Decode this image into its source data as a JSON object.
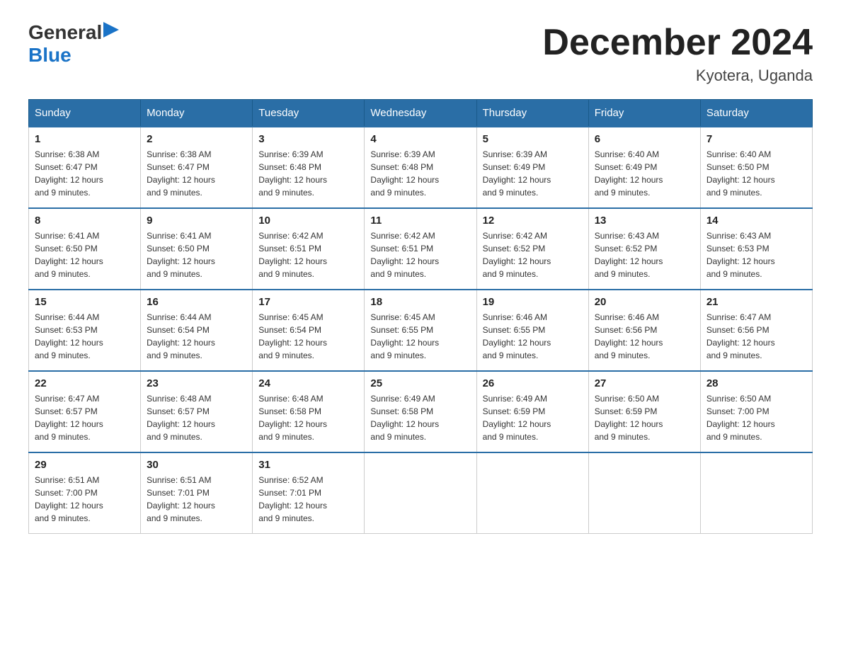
{
  "logo": {
    "general": "General",
    "blue": "Blue"
  },
  "title": "December 2024",
  "subtitle": "Kyotera, Uganda",
  "weekdays": [
    "Sunday",
    "Monday",
    "Tuesday",
    "Wednesday",
    "Thursday",
    "Friday",
    "Saturday"
  ],
  "weeks": [
    [
      {
        "day": "1",
        "sunrise": "6:38 AM",
        "sunset": "6:47 PM",
        "daylight": "12 hours and 9 minutes."
      },
      {
        "day": "2",
        "sunrise": "6:38 AM",
        "sunset": "6:47 PM",
        "daylight": "12 hours and 9 minutes."
      },
      {
        "day": "3",
        "sunrise": "6:39 AM",
        "sunset": "6:48 PM",
        "daylight": "12 hours and 9 minutes."
      },
      {
        "day": "4",
        "sunrise": "6:39 AM",
        "sunset": "6:48 PM",
        "daylight": "12 hours and 9 minutes."
      },
      {
        "day": "5",
        "sunrise": "6:39 AM",
        "sunset": "6:49 PM",
        "daylight": "12 hours and 9 minutes."
      },
      {
        "day": "6",
        "sunrise": "6:40 AM",
        "sunset": "6:49 PM",
        "daylight": "12 hours and 9 minutes."
      },
      {
        "day": "7",
        "sunrise": "6:40 AM",
        "sunset": "6:50 PM",
        "daylight": "12 hours and 9 minutes."
      }
    ],
    [
      {
        "day": "8",
        "sunrise": "6:41 AM",
        "sunset": "6:50 PM",
        "daylight": "12 hours and 9 minutes."
      },
      {
        "day": "9",
        "sunrise": "6:41 AM",
        "sunset": "6:50 PM",
        "daylight": "12 hours and 9 minutes."
      },
      {
        "day": "10",
        "sunrise": "6:42 AM",
        "sunset": "6:51 PM",
        "daylight": "12 hours and 9 minutes."
      },
      {
        "day": "11",
        "sunrise": "6:42 AM",
        "sunset": "6:51 PM",
        "daylight": "12 hours and 9 minutes."
      },
      {
        "day": "12",
        "sunrise": "6:42 AM",
        "sunset": "6:52 PM",
        "daylight": "12 hours and 9 minutes."
      },
      {
        "day": "13",
        "sunrise": "6:43 AM",
        "sunset": "6:52 PM",
        "daylight": "12 hours and 9 minutes."
      },
      {
        "day": "14",
        "sunrise": "6:43 AM",
        "sunset": "6:53 PM",
        "daylight": "12 hours and 9 minutes."
      }
    ],
    [
      {
        "day": "15",
        "sunrise": "6:44 AM",
        "sunset": "6:53 PM",
        "daylight": "12 hours and 9 minutes."
      },
      {
        "day": "16",
        "sunrise": "6:44 AM",
        "sunset": "6:54 PM",
        "daylight": "12 hours and 9 minutes."
      },
      {
        "day": "17",
        "sunrise": "6:45 AM",
        "sunset": "6:54 PM",
        "daylight": "12 hours and 9 minutes."
      },
      {
        "day": "18",
        "sunrise": "6:45 AM",
        "sunset": "6:55 PM",
        "daylight": "12 hours and 9 minutes."
      },
      {
        "day": "19",
        "sunrise": "6:46 AM",
        "sunset": "6:55 PM",
        "daylight": "12 hours and 9 minutes."
      },
      {
        "day": "20",
        "sunrise": "6:46 AM",
        "sunset": "6:56 PM",
        "daylight": "12 hours and 9 minutes."
      },
      {
        "day": "21",
        "sunrise": "6:47 AM",
        "sunset": "6:56 PM",
        "daylight": "12 hours and 9 minutes."
      }
    ],
    [
      {
        "day": "22",
        "sunrise": "6:47 AM",
        "sunset": "6:57 PM",
        "daylight": "12 hours and 9 minutes."
      },
      {
        "day": "23",
        "sunrise": "6:48 AM",
        "sunset": "6:57 PM",
        "daylight": "12 hours and 9 minutes."
      },
      {
        "day": "24",
        "sunrise": "6:48 AM",
        "sunset": "6:58 PM",
        "daylight": "12 hours and 9 minutes."
      },
      {
        "day": "25",
        "sunrise": "6:49 AM",
        "sunset": "6:58 PM",
        "daylight": "12 hours and 9 minutes."
      },
      {
        "day": "26",
        "sunrise": "6:49 AM",
        "sunset": "6:59 PM",
        "daylight": "12 hours and 9 minutes."
      },
      {
        "day": "27",
        "sunrise": "6:50 AM",
        "sunset": "6:59 PM",
        "daylight": "12 hours and 9 minutes."
      },
      {
        "day": "28",
        "sunrise": "6:50 AM",
        "sunset": "7:00 PM",
        "daylight": "12 hours and 9 minutes."
      }
    ],
    [
      {
        "day": "29",
        "sunrise": "6:51 AM",
        "sunset": "7:00 PM",
        "daylight": "12 hours and 9 minutes."
      },
      {
        "day": "30",
        "sunrise": "6:51 AM",
        "sunset": "7:01 PM",
        "daylight": "12 hours and 9 minutes."
      },
      {
        "day": "31",
        "sunrise": "6:52 AM",
        "sunset": "7:01 PM",
        "daylight": "12 hours and 9 minutes."
      },
      null,
      null,
      null,
      null
    ]
  ],
  "labels": {
    "sunrise": "Sunrise:",
    "sunset": "Sunset:",
    "daylight": "Daylight:"
  }
}
